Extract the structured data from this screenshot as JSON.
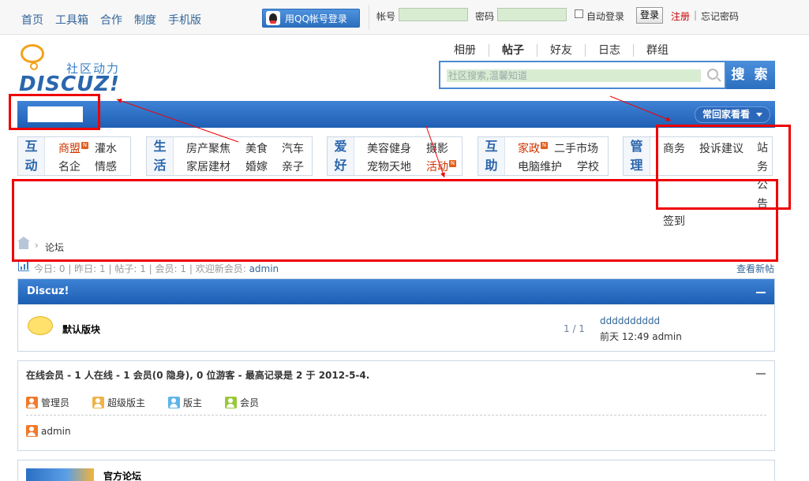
{
  "topnav": [
    "首页",
    "工具箱",
    "合作",
    "制度",
    "手机版"
  ],
  "qq_login": "用QQ帐号登录",
  "login": {
    "account_label": "帐号",
    "password_label": "密码",
    "auto_login": "自动登录",
    "login_button": "登录",
    "register": "注册",
    "separator": "|",
    "forgot": "忘记密码"
  },
  "logo": {
    "cn": "社区动力",
    "en": "DISCUZ!"
  },
  "search": {
    "tabs": [
      "相册",
      "帖子",
      "好友",
      "日志",
      "群组"
    ],
    "active_tab": "帖子",
    "placeholder": "社区搜索,温馨知道",
    "button": "搜 索"
  },
  "nav": {
    "often_visit": "常回家看看"
  },
  "categories": [
    {
      "title": [
        "互",
        "动"
      ],
      "items": [
        {
          "label": "商盟",
          "hot": true,
          "red": true
        },
        {
          "label": "灌水"
        },
        {
          "label": "名企"
        },
        {
          "label": "情感"
        }
      ]
    },
    {
      "title": [
        "生",
        "活"
      ],
      "items": [
        {
          "label": "房产聚焦"
        },
        {
          "label": "美食"
        },
        {
          "label": "汽车"
        },
        {
          "label": "家居建材"
        },
        {
          "label": "婚嫁"
        },
        {
          "label": "亲子"
        }
      ]
    },
    {
      "title": [
        "爱",
        "好"
      ],
      "items": [
        {
          "label": "美容健身"
        },
        {
          "label": "摄影"
        },
        {
          "label": "宠物天地"
        },
        {
          "label": "活动",
          "hot": true,
          "red": true
        }
      ]
    },
    {
      "title": [
        "互",
        "助"
      ],
      "items": [
        {
          "label": "家政",
          "hot": true,
          "red": true
        },
        {
          "label": "二手市场"
        },
        {
          "label": "电脑维护"
        },
        {
          "label": "学校"
        }
      ]
    },
    {
      "title": [
        "管",
        "理"
      ],
      "items": [
        {
          "label": "商务"
        },
        {
          "label": "投诉建议"
        },
        {
          "label": "站务公告"
        },
        {
          "label": "签到"
        }
      ]
    }
  ],
  "hot_badge": "N",
  "breadcrumb": {
    "sep": "›",
    "forum": "论坛"
  },
  "stats": {
    "today": "今日: 0",
    "yesterday": "昨日: 1",
    "posts": "帖子: 1",
    "members": "会员: 1",
    "welcome": "欢迎新会员:",
    "new_member": "admin",
    "new_posts": "查看新帖"
  },
  "forum_block": {
    "title": "Discuz!",
    "forum_name": "默认版块",
    "count": "1 / 1",
    "last_post": "dddddddddd",
    "last_time": "前天 12:49 admin"
  },
  "online": {
    "heading": "在线会员 - 1 人在线 - 1 会员(0 隐身), 0 位游客 - 最高记录是 2 于 2012-5-4.",
    "roles": [
      "管理员",
      "超级版主",
      "版主",
      "会员"
    ],
    "users": [
      "admin"
    ]
  },
  "official": {
    "title": "官方论坛"
  }
}
